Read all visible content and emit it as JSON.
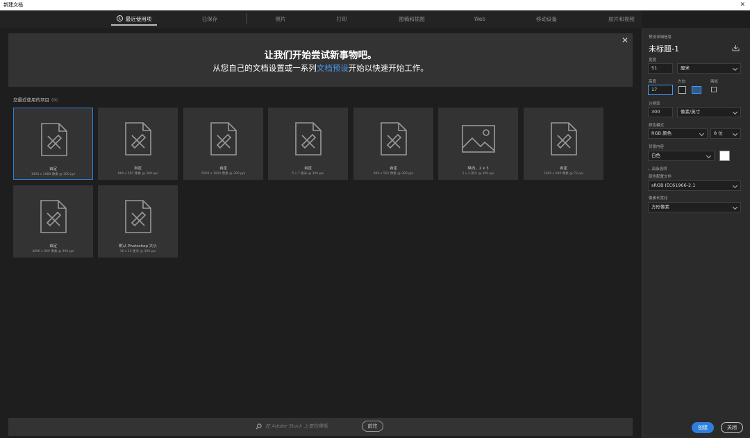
{
  "window": {
    "title": "新建文档",
    "close_glyph": "✕"
  },
  "tabs": [
    {
      "label": "最近使用项",
      "active": true
    },
    {
      "label": "已保存"
    },
    {
      "label": "照片"
    },
    {
      "label": "打印"
    },
    {
      "label": "图稿和插图"
    },
    {
      "label": "Web"
    },
    {
      "label": "移动设备"
    },
    {
      "label": "胶片和视频"
    }
  ],
  "banner": {
    "headline": "让我们开始尝试新事物吧。",
    "line_pre": "从您自己的文档设置或一系列",
    "line_link": "文档预设",
    "line_post": "开始以快速开始工作。",
    "close_glyph": "✕"
  },
  "recent": {
    "title": "您最近使用的项目",
    "count": "(9)",
    "items": [
      {
        "name": "自定",
        "sub": "1920 x 1080 像素 @ 300 ppi",
        "icon": "document-brush-icon",
        "selected": true
      },
      {
        "name": "自定",
        "sub": "860 x 591 像素 @ 300 ppi",
        "icon": "document-brush-icon"
      },
      {
        "name": "自定",
        "sub": "5000 x 1920 像素 @ 300 ppi",
        "icon": "document-brush-icon"
      },
      {
        "name": "自定",
        "sub": "5 x 7 厘米 @ 300 ppi",
        "icon": "document-brush-icon"
      },
      {
        "name": "自定",
        "sub": "860 x 591 像素 @ 300 ppi",
        "icon": "document-brush-icon"
      },
      {
        "name": "纵向，2 x 3",
        "sub": "2 x 3 英寸 @ 300 ppi",
        "icon": "image-icon"
      },
      {
        "name": "自定",
        "sub": "1900 x 990 像素 @ 72 ppi",
        "icon": "document-brush-icon"
      },
      {
        "name": "自定",
        "sub": "4096 x 960 像素 @ 300 ppi",
        "icon": "document-brush-icon"
      },
      {
        "name": "默认 Photoshop 大小",
        "sub": "16 x 12 厘米 @ 300 ppi",
        "icon": "document-brush-icon"
      }
    ]
  },
  "bottom": {
    "search_placeholder": "在 Adobe Stock 上查找模板",
    "go_label": "前往"
  },
  "preset": {
    "section_label": "预设详细信息",
    "doc_name": "未标题-1",
    "width_label": "宽度",
    "width_value": "51",
    "width_unit": "厘米",
    "height_label": "高度",
    "height_value": "17",
    "orientation_label": "方向",
    "artboard_label": "画板",
    "resolution_label": "分辨率",
    "resolution_value": "300",
    "resolution_unit": "像素/英寸",
    "color_mode_label": "颜色模式",
    "color_mode_value": "RGB 颜色",
    "bit_depth_value": "8 位",
    "bg_label": "背景内容",
    "bg_value": "白色",
    "bg_color": "#ffffff",
    "advanced_label": "高级选项",
    "profile_label": "颜色配置文件",
    "profile_value": "sRGB IEC61966-2.1",
    "pixel_aspect_label": "像素长宽比",
    "pixel_aspect_value": "方形像素"
  },
  "actions": {
    "create_label": "创建",
    "close_label": "关闭"
  },
  "colors": {
    "accent": "#2d7fdc",
    "link": "#4a98f2"
  }
}
